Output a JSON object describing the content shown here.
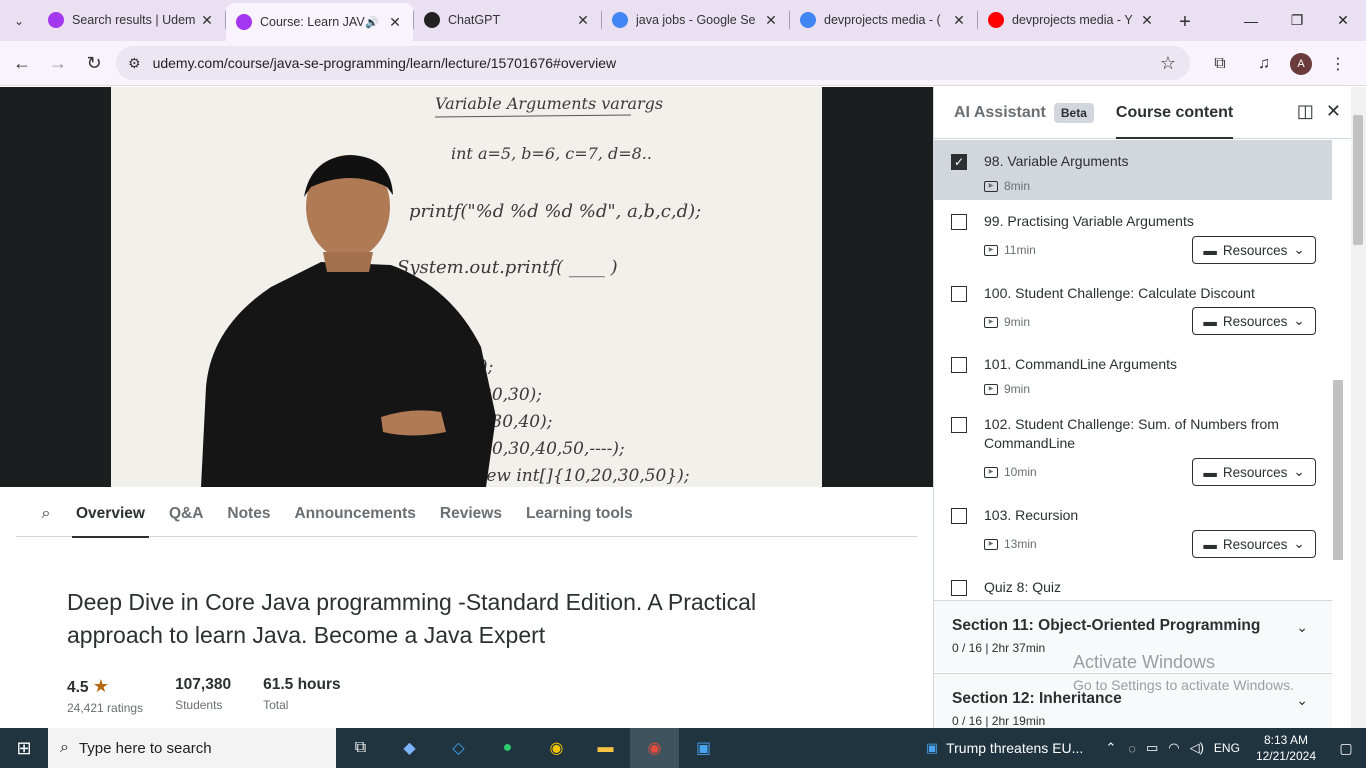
{
  "browser": {
    "tabs": [
      {
        "title": "Search results | Udem",
        "icon": "udemy-icon",
        "favcolor": "#a435f0"
      },
      {
        "title": "Course: Learn JAV",
        "icon": "udemy-icon",
        "favcolor": "#a435f0",
        "active": true
      },
      {
        "title": "ChatGPT",
        "icon": "chatgpt-icon",
        "favcolor": "#222"
      },
      {
        "title": "java jobs - Google Se",
        "icon": "google-icon",
        "favcolor": "#4285f4"
      },
      {
        "title": "devprojects media - (",
        "icon": "google-icon",
        "favcolor": "#4285f4"
      },
      {
        "title": "devprojects media - Y",
        "icon": "youtube-icon",
        "favcolor": "#ff0000"
      }
    ],
    "url": "udemy.com/course/java-se-programming/learn/lecture/15701676#overview",
    "avatar": "A"
  },
  "video": {
    "board_lines": [
      "Variable Arguments varargs",
      "int a=5, b=6, c=7, d=8..",
      "printf(\"%d %d %d %d\", a,b,c,d);",
      "System.out.printf( ____ )",
      ");",
      "20,30);",
      ",30,40);",
      "w(10,20,30,40,50,----);",
      "how(new int[]{10,20,30,50});"
    ]
  },
  "lecture_tabs": [
    "Overview",
    "Q&A",
    "Notes",
    "Announcements",
    "Reviews",
    "Learning tools"
  ],
  "course": {
    "title": "Deep Dive in Core Java programming -Standard Edition. A Practical approach to learn Java. Become a Java Expert",
    "rating": "4.5",
    "ratings_count": "24,421 ratings",
    "students": "107,380",
    "students_label": "Students",
    "hours": "61.5 hours",
    "hours_label": "Total"
  },
  "sidebar": {
    "tab_ai": "AI Assistant",
    "beta": "Beta",
    "tab_content": "Course content",
    "items": [
      {
        "name": "98. Variable Arguments",
        "dur": "8min",
        "checked": true,
        "current": true,
        "resources": false
      },
      {
        "name": "99. Practising Variable Arguments",
        "dur": "11min",
        "checked": false,
        "resources": true
      },
      {
        "name": "100. Student Challenge: Calculate Discount",
        "dur": "9min",
        "checked": false,
        "resources": true
      },
      {
        "name": "101. CommandLine Arguments",
        "dur": "9min",
        "checked": false,
        "resources": false
      },
      {
        "name": "102. Student Challenge: Sum. of Numbers from CommandLine",
        "dur": "10min",
        "checked": false,
        "resources": true
      },
      {
        "name": "103. Recursion",
        "dur": "13min",
        "checked": false,
        "resources": true
      },
      {
        "name": "Quiz 8: Quiz",
        "dur": "",
        "checked": false,
        "resources": false
      }
    ],
    "resources_label": "Resources",
    "sections": [
      {
        "title": "Section 11: Object-Oriented Programming",
        "sub": "0 / 16 | 2hr 37min"
      },
      {
        "title": "Section 12: Inheritance",
        "sub": "0 / 16 | 2hr 19min"
      }
    ]
  },
  "watermark": {
    "line1": "Activate Windows",
    "line2": "Go to Settings to activate Windows."
  },
  "taskbar": {
    "search_placeholder": "Type here to search",
    "news": "Trump threatens EU...",
    "lang": "ENG",
    "time": "8:13 AM",
    "date": "12/21/2024"
  }
}
